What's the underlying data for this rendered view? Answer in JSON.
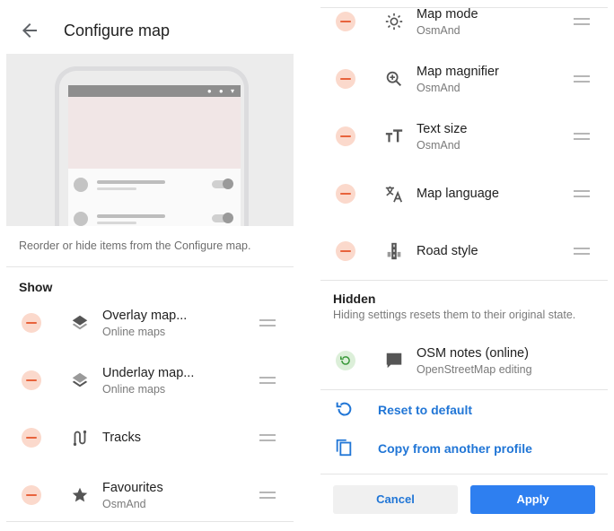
{
  "header": {
    "title": "Configure map"
  },
  "illustration": {
    "dots": "● ● ▾"
  },
  "description": "Reorder or hide items from the Configure map.",
  "show_section": {
    "title": "Show",
    "items": [
      {
        "title": "Overlay map...",
        "subtitle": "Online maps",
        "icon": "layers-icon"
      },
      {
        "title": "Underlay map...",
        "subtitle": "Online maps",
        "icon": "layers-icon"
      },
      {
        "title": "Tracks",
        "subtitle": "",
        "icon": "tracks-icon"
      },
      {
        "title": "Favourites",
        "subtitle": "OsmAnd",
        "icon": "star-icon"
      }
    ]
  },
  "show_section_continued": {
    "items": [
      {
        "title": "Map mode",
        "subtitle": "OsmAnd",
        "icon": "sun-icon"
      },
      {
        "title": "Map magnifier",
        "subtitle": "OsmAnd",
        "icon": "magnifier-icon"
      },
      {
        "title": "Text size",
        "subtitle": "OsmAnd",
        "icon": "text-size-icon"
      },
      {
        "title": "Map language",
        "subtitle": "",
        "icon": "translate-icon"
      },
      {
        "title": "Road style",
        "subtitle": "",
        "icon": "road-icon"
      }
    ]
  },
  "hidden_section": {
    "title": "Hidden",
    "description": "Hiding settings resets them to their original state.",
    "items": [
      {
        "title": "OSM notes (online)",
        "subtitle": "OpenStreetMap editing",
        "icon": "comment-icon"
      }
    ]
  },
  "actions": {
    "reset": "Reset to default",
    "copy": "Copy from another profile"
  },
  "buttons": {
    "cancel": "Cancel",
    "apply": "Apply"
  },
  "colors": {
    "accent": "#2176d6",
    "apply_bg": "#2e7ff0",
    "remove_bg": "#fbd9cc",
    "remove_fg": "#e8633c",
    "restore_bg": "#dcefd9",
    "restore_fg": "#3c9a3c"
  }
}
